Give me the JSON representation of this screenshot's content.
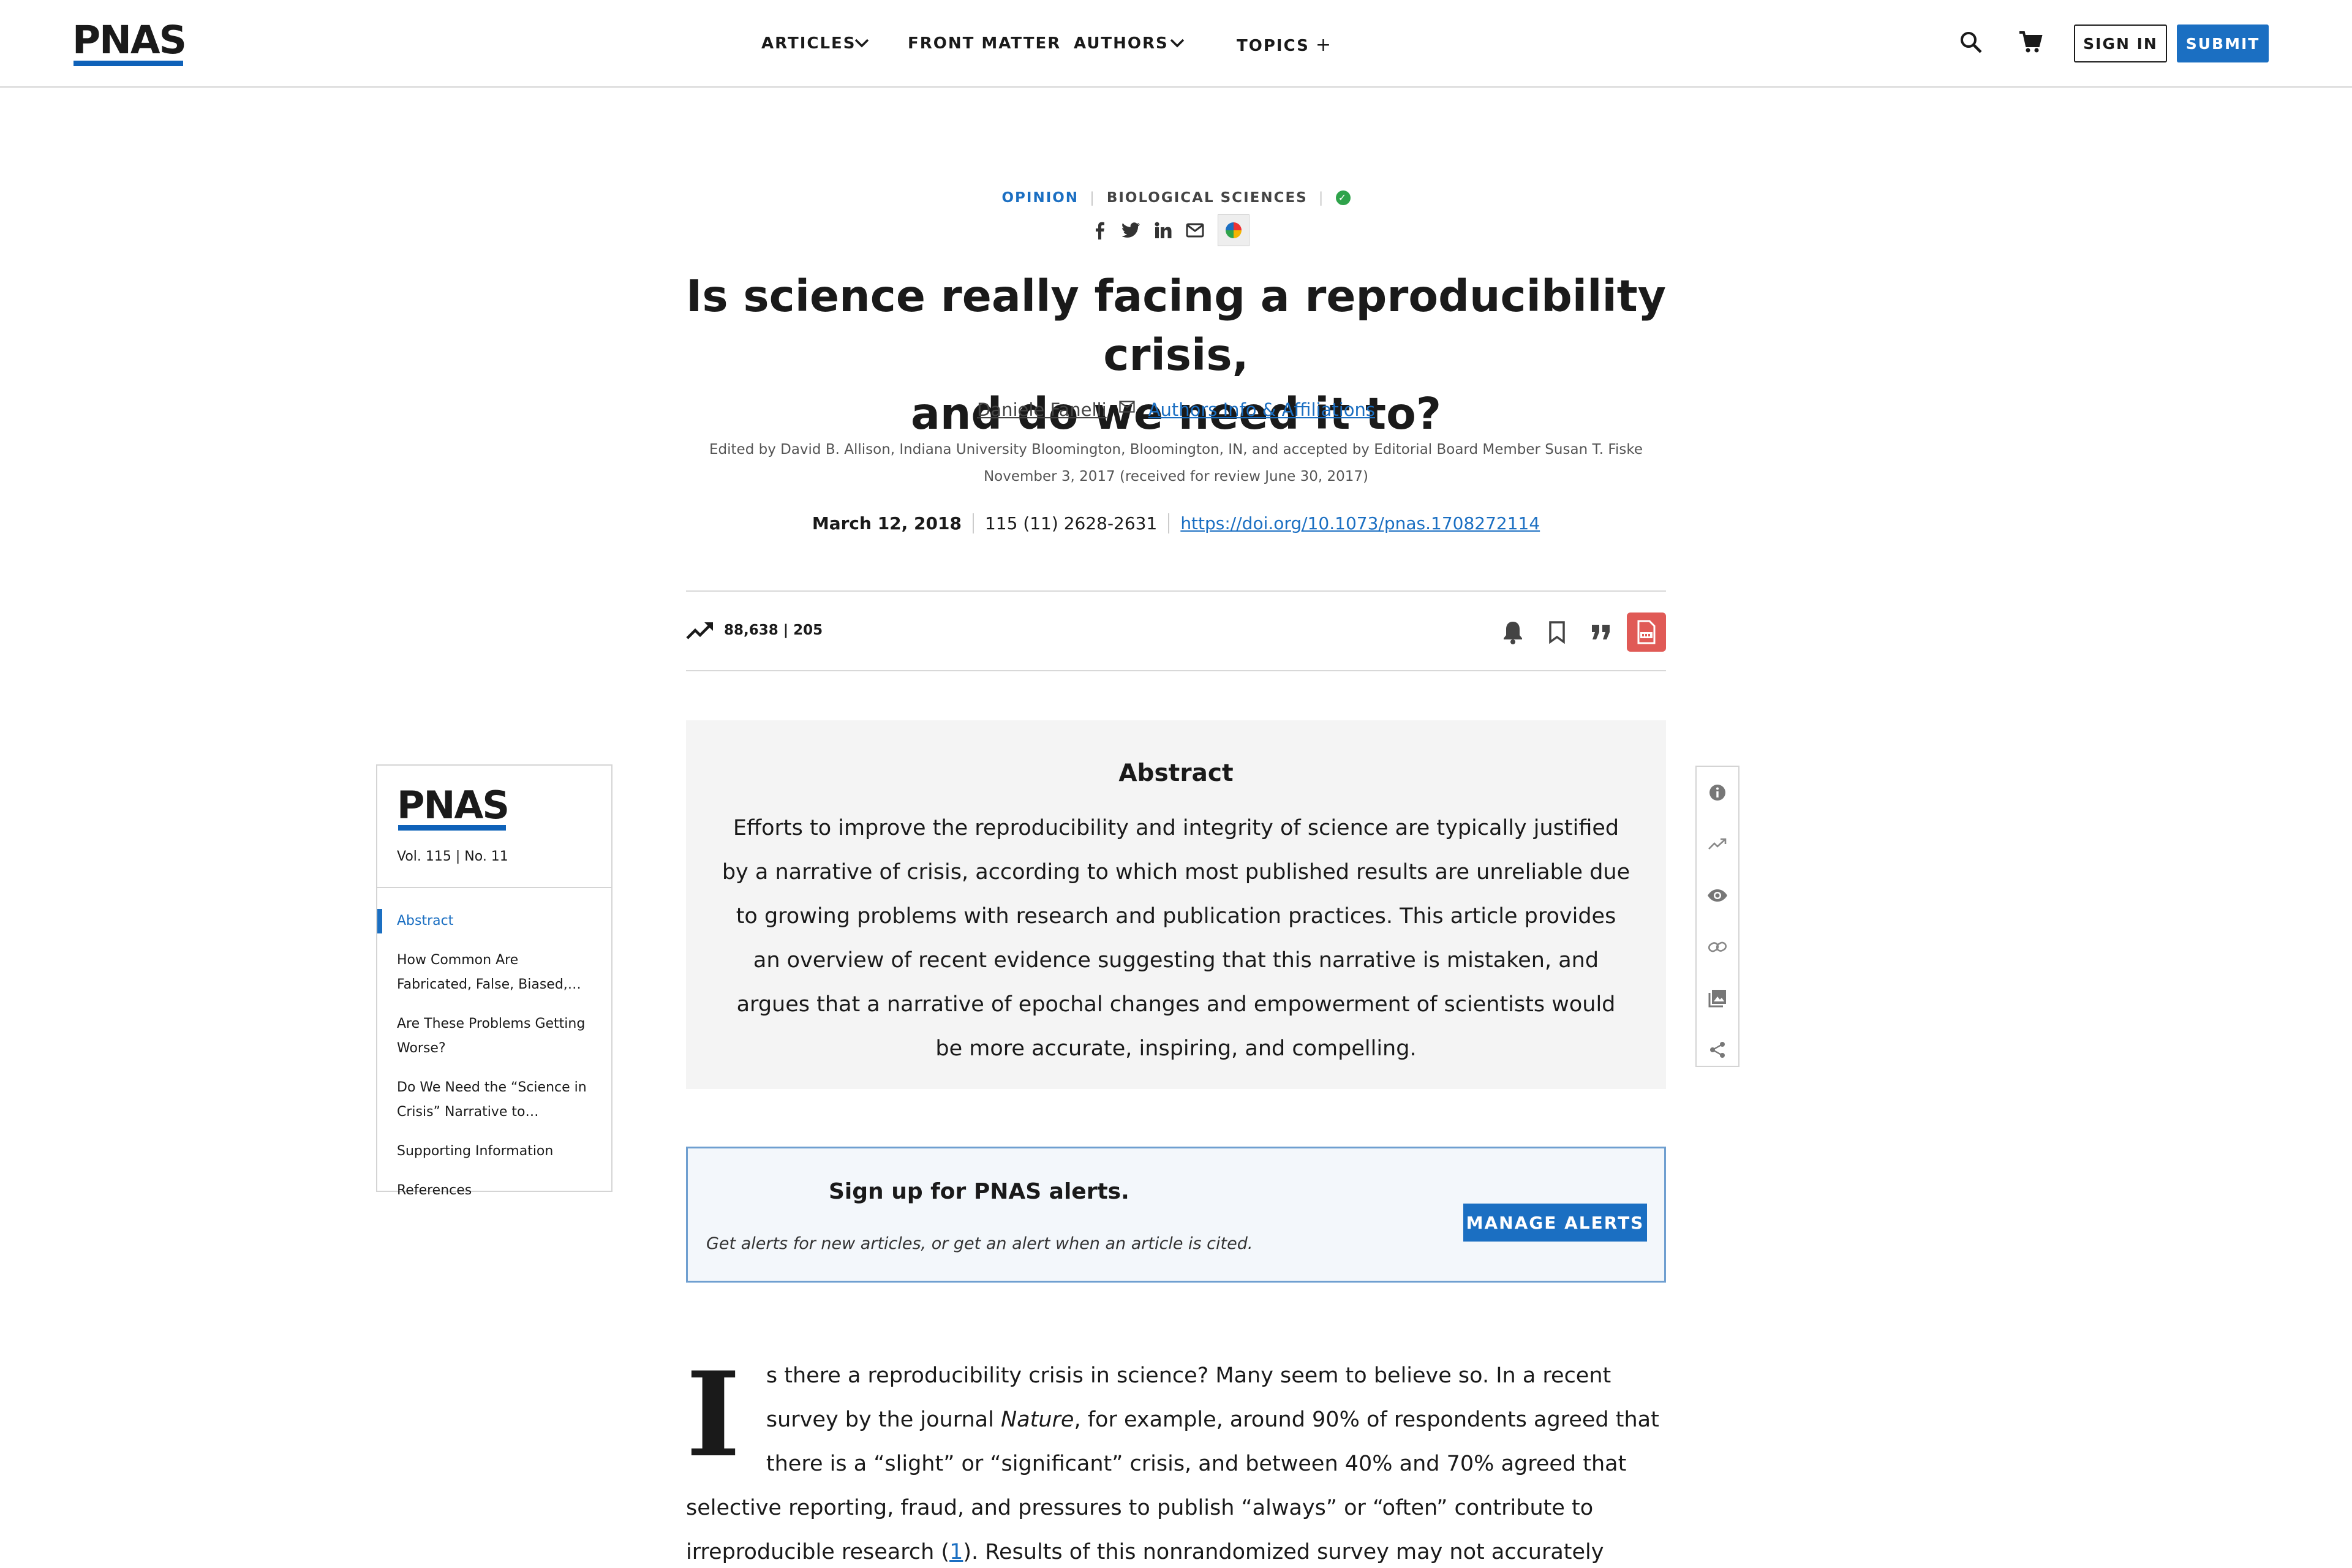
{
  "header": {
    "logo": "PNAS",
    "nav": {
      "articles": "ARTICLES",
      "front_matter": "FRONT MATTER",
      "authors": "AUTHORS",
      "topics": "TOPICS",
      "topics_symbol": "+"
    },
    "sign_in": "SIGN IN",
    "submit": "SUBMIT",
    "icons": [
      "search-icon",
      "cart-icon"
    ]
  },
  "article": {
    "category": "OPINION",
    "subject": "BIOLOGICAL SCIENCES",
    "title_line1": "Is science really facing a reproducibility crisis,",
    "title_line2": "and do we need it to?",
    "author": "Daniele Fanelli",
    "affiliations_link": "Authors Info & Affiliations",
    "edited_by": "Edited by David B. Allison, Indiana University Bloomington, Bloomington, IN, and accepted by Editorial Board Member Susan T. Fiske November 3, 2017 (received for review June 30, 2017)",
    "date": "March 12, 2018",
    "volume_pages": "115 (11) 2628-2631",
    "doi": "https://doi.org/10.1073/pnas.1708272114",
    "metrics": "88,638 | 205",
    "share_icons": [
      "facebook-icon",
      "twitter-icon",
      "linkedin-icon",
      "email-icon"
    ]
  },
  "toc": {
    "logo": "PNAS",
    "volume": "Vol. 115 | No. 11",
    "items": [
      "Abstract",
      "How Common Are Fabricated, False, Biased,…",
      "Are These Problems Getting Worse?",
      "Do We Need the “Science in Crisis” Narrative to…",
      "Supporting Information",
      "References"
    ]
  },
  "abstract": {
    "heading": "Abstract",
    "text": "Efforts to improve the reproducibility and integrity of science are typically justified by a narrative of crisis, according to which most published results are unreliable due to growing problems with research and publication practices. This article provides an overview of recent evidence suggesting that this narrative is mistaken, and argues that a narrative of epochal changes and empowerment of scientists would be more accurate, inspiring, and compelling."
  },
  "tools": [
    "info-icon",
    "trending-icon",
    "eye-icon",
    "link-icon",
    "images-icon",
    "share-icon"
  ],
  "alerts": {
    "heading": "Sign up for PNAS alerts.",
    "sub": "Get alerts for new articles, or get an alert when an article is cited.",
    "button": "MANAGE ALERTS"
  },
  "body": {
    "dropcap": "I",
    "p1_a": "s there a reproducibility crisis in science? Many seem to believe so. In a recent survey by the journal ",
    "p1_em": "Nature",
    "p1_b": ", for example, around 90% of respondents agreed that there is a “slight” or “significant” crisis, and between 40% and 70% agreed that selective reporting, fraud, and pressures to publish “always” or “often” contribute to irreproducible research (",
    "p1_ref": "1",
    "p1_c": "). Results of this nonrandomized survey may not accurately represent the population of practicing"
  },
  "colors": {
    "brand_blue": "#1b6fc2",
    "pdf_red": "#e05a56",
    "check_green": "#2fa34b"
  }
}
